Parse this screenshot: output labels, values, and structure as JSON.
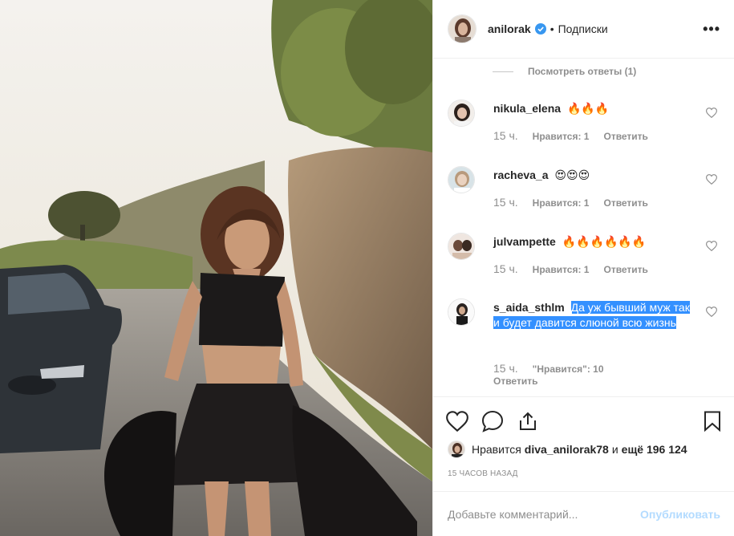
{
  "header": {
    "username": "anilorak",
    "dot": "•",
    "follow_label": "Подписки",
    "more_label": "•••"
  },
  "view_replies": "Посмотреть ответы (1)",
  "comments": [
    {
      "username": "nikula_elena",
      "text": "🔥🔥🔥",
      "time": "15 ч.",
      "likes": "Нравится: 1",
      "reply": "Ответить"
    },
    {
      "username": "racheva_a",
      "text": "😍😍😍",
      "time": "15 ч.",
      "likes": "Нравится: 1",
      "reply": "Ответить"
    },
    {
      "username": "julvampette",
      "text": "🔥🔥🔥🔥🔥🔥",
      "time": "15 ч.",
      "likes": "Нравится: 1",
      "reply": "Ответить"
    },
    {
      "username": "s_aida_sthlm",
      "text": "Да уж бывший муж так и будет давится слюной всю жизнь",
      "time": "15 ч.",
      "likes": "\"Нравится\": 10",
      "reply": "Ответить"
    }
  ],
  "likes_line": {
    "prefix": "Нравится",
    "user": "diva_anilorak78",
    "middle": "и",
    "count": "ещё 196 124"
  },
  "timestamp": "15 часов назад",
  "add_comment": {
    "placeholder": "Добавьте комментарий...",
    "publish_label": "Опубликовать"
  },
  "colors": {
    "accent_blue": "#3897f0",
    "selection": "#3390ff",
    "muted": "#8e8e8e",
    "publish_disabled": "#b3dbff"
  }
}
